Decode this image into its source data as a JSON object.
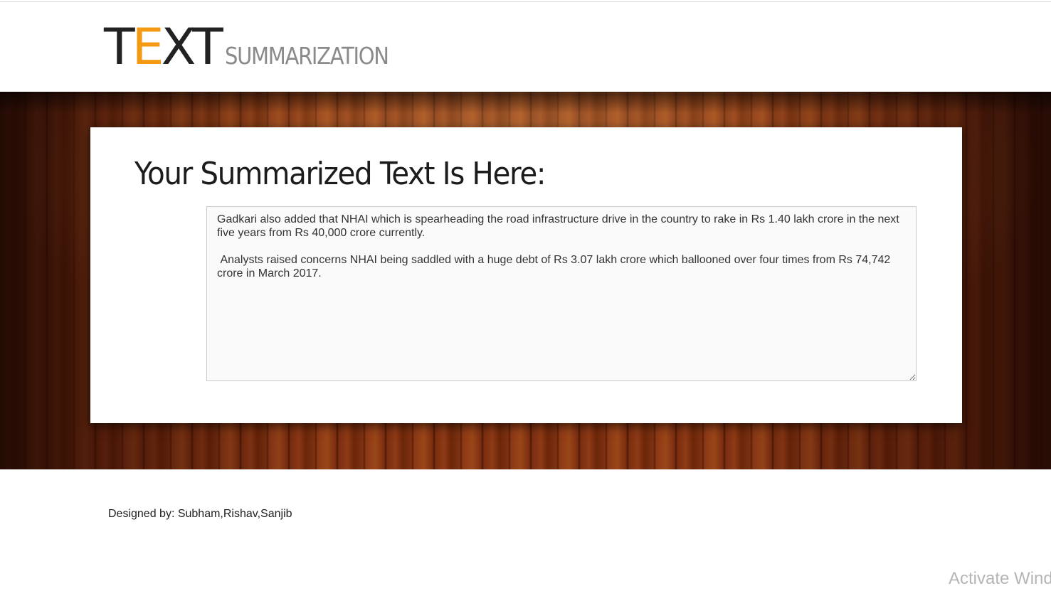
{
  "header": {
    "logo_main_first": "T",
    "logo_main_accent": "E",
    "logo_main_rest": "XT",
    "logo_sub": "SUMMARIZATION",
    "accent_color": "#f39a12"
  },
  "main": {
    "title": "Your Summarized Text Is Here:",
    "summary_text": "Gadkari also added that NHAI which is spearheading the road infrastructure drive in the country to rake in Rs 1.40 lakh crore in the next five years from Rs 40,000 crore currently.\n\n Analysts raised concerns NHAI being saddled with a huge debt of Rs 3.07 lakh crore which ballooned over four times from Rs 74,742 crore in March 2017."
  },
  "footer": {
    "credits": "Designed by: Subham,Rishav,Sanjib"
  },
  "watermark": {
    "text": "Activate Wind"
  }
}
